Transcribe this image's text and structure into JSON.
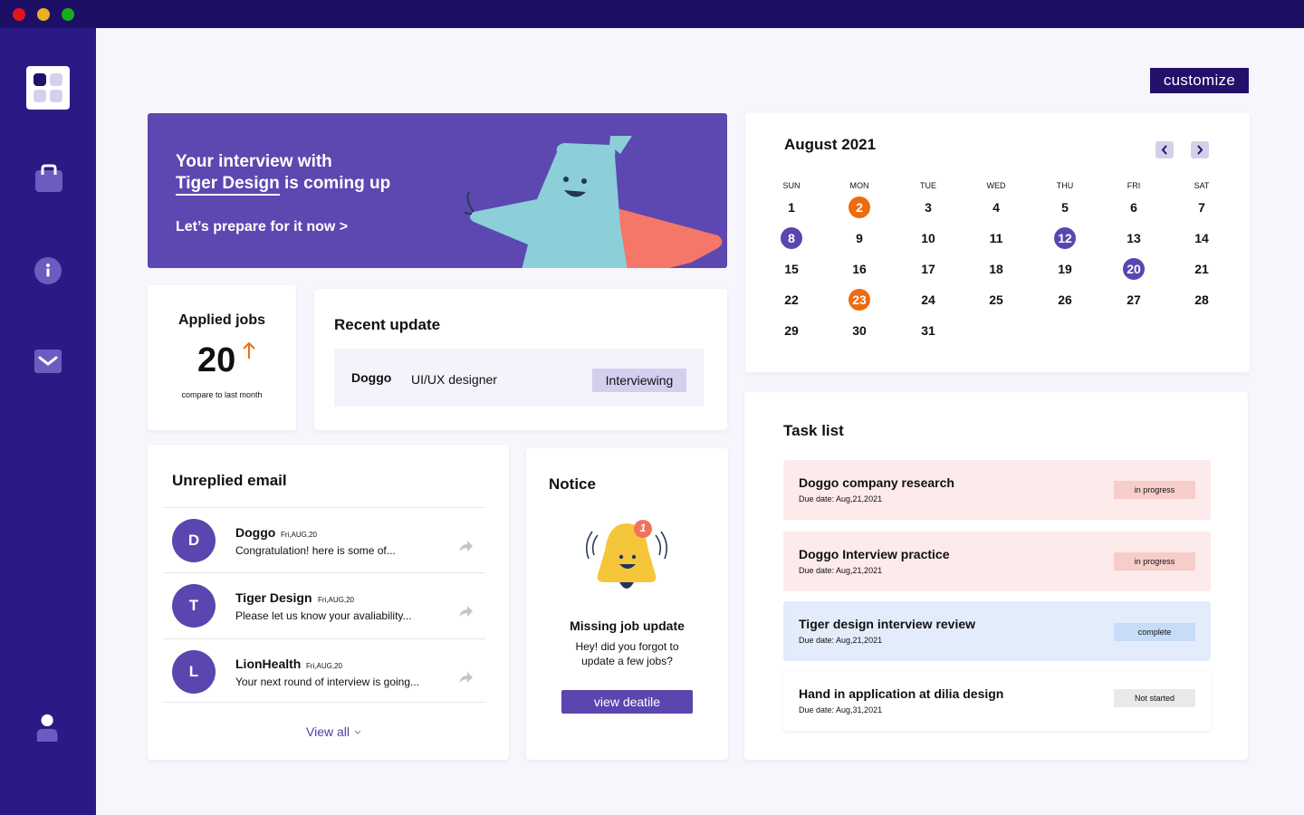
{
  "window": {
    "controls": {
      "close": "#e1161b",
      "minimize": "#e8b21e",
      "maximize": "#16ad1c"
    }
  },
  "colors": {
    "titlebar": "#1d0f66",
    "sidebar": "#2b1a86",
    "accent": "#5a46ae",
    "orange": "#ee6b0e",
    "background": "#f6f6fc"
  },
  "sidebar": {
    "items": [
      {
        "icon": "dashboard-icon"
      },
      {
        "icon": "briefcase-icon"
      },
      {
        "icon": "info-icon"
      },
      {
        "icon": "mail-icon"
      }
    ],
    "bottom_icon": "user-icon"
  },
  "header": {
    "customize_label": "customize"
  },
  "banner": {
    "line1": "Your interview with",
    "company": "Tiger Design",
    "line2_rest": " is coming up",
    "cta": "Let’s prepare for it now >"
  },
  "applied_jobs": {
    "title": "Applied jobs",
    "count": "20",
    "trend": "up",
    "caption": "compare to last month"
  },
  "recent_update": {
    "title": "Recent update",
    "company": "Doggo",
    "role": "UI/UX designer",
    "status": "Interviewing"
  },
  "calendar": {
    "title": "August 2021",
    "weekdays": [
      "SUN",
      "MON",
      "TUE",
      "WED",
      "THU",
      "FRI",
      "SAT"
    ],
    "weeks": [
      [
        "1",
        "2",
        "3",
        "4",
        "5",
        "6",
        "7"
      ],
      [
        "8",
        "9",
        "10",
        "11",
        "12",
        "13",
        "14"
      ],
      [
        "15",
        "16",
        "17",
        "18",
        "19",
        "20",
        "21"
      ],
      [
        "22",
        "23",
        "24",
        "25",
        "26",
        "27",
        "28"
      ],
      [
        "29",
        "30",
        "31",
        "",
        "",
        "",
        ""
      ]
    ],
    "highlighted_orange": [
      "2",
      "23"
    ],
    "highlighted_purple": [
      "8",
      "12",
      "20"
    ]
  },
  "email": {
    "title": "Unreplied email",
    "items": [
      {
        "initial": "D",
        "sender": "Doggo",
        "date": "Fri,AUG,20",
        "preview": "Congratulation! here is some of..."
      },
      {
        "initial": "T",
        "sender": "Tiger Design",
        "date": "Fri,AUG,20",
        "preview": "Please let us know your avaliability..."
      },
      {
        "initial": "L",
        "sender": "LionHealth",
        "date": "Fri,AUG,20",
        "preview": "Your next round of interview is going..."
      }
    ],
    "view_all": "View all"
  },
  "notice": {
    "title": "Notice",
    "badge": "1",
    "heading": "Missing job update",
    "body_line1": "Hey! did you forgot to",
    "body_line2": "update a few jobs?",
    "button": "view deatile"
  },
  "tasks": {
    "title": "Task list",
    "items": [
      {
        "title": "Doggo company research",
        "due": "Due date: Aug,21,2021",
        "status": "in progress",
        "bg": "#fdeaea",
        "badge": "#f6cdc8"
      },
      {
        "title": "Doggo Interview practice",
        "due": "Due date: Aug,21,2021",
        "status": "in progress",
        "bg": "#fdeaea",
        "badge": "#f6cdc8"
      },
      {
        "title": "Tiger design interview review",
        "due": "Due date: Aug,21,2021",
        "status": "complete",
        "bg": "#e3ecfb",
        "badge": "#c6dcf7"
      },
      {
        "title": "Hand in application at dilia design",
        "due": "Due date: Aug,31,2021",
        "status": "Not started",
        "bg": "#ffffff",
        "badge": "#e9e9e9"
      }
    ]
  }
}
